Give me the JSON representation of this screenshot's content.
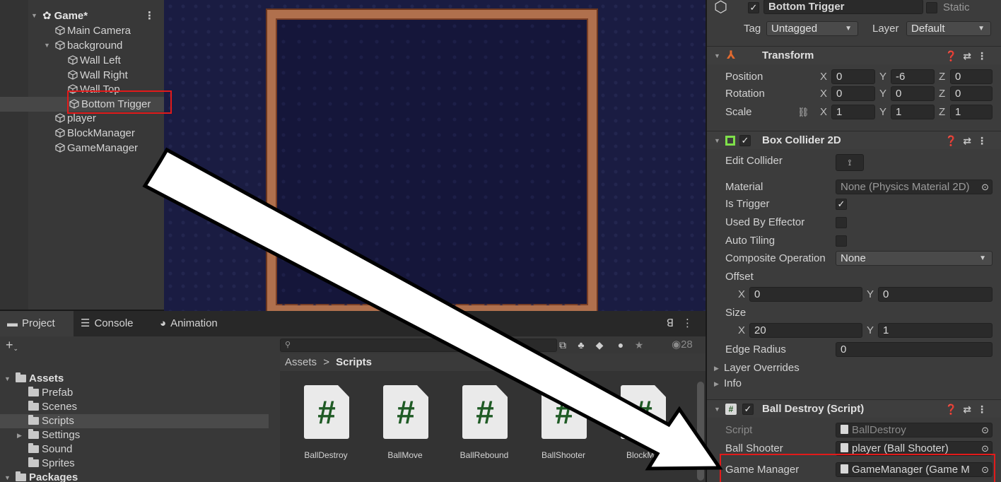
{
  "hierarchy": {
    "scene_name": "Game*",
    "items": [
      {
        "label": "Main Camera"
      },
      {
        "label": "background"
      },
      {
        "label": "Wall Left"
      },
      {
        "label": "Wall Right"
      },
      {
        "label": "Wall Top"
      },
      {
        "label": "Bottom Trigger"
      },
      {
        "label": "player"
      },
      {
        "label": "BlockManager"
      },
      {
        "label": "GameManager"
      }
    ]
  },
  "project_panel": {
    "tabs": [
      {
        "label": "Project",
        "icon": "folder-icon"
      },
      {
        "label": "Console",
        "icon": "console-icon"
      },
      {
        "label": "Animation",
        "icon": "animation-icon"
      }
    ],
    "search_placeholder": "",
    "hidden_count": "28",
    "tree": [
      {
        "label": "Assets"
      },
      {
        "label": "Prefab"
      },
      {
        "label": "Scenes"
      },
      {
        "label": "Scripts"
      },
      {
        "label": "Settings"
      },
      {
        "label": "Sound"
      },
      {
        "label": "Sprites"
      },
      {
        "label": "Packages"
      }
    ],
    "breadcrumb_root": "Assets",
    "breadcrumb_sep": ">",
    "breadcrumb_current": "Scripts",
    "assets": [
      {
        "name": "BallDestroy",
        "glyph": "#"
      },
      {
        "name": "BallMove",
        "glyph": "#"
      },
      {
        "name": "BallRebound",
        "glyph": "#"
      },
      {
        "name": "BallShooter",
        "glyph": "#"
      },
      {
        "name": "BlockMa",
        "glyph": "#"
      }
    ]
  },
  "inspector": {
    "object_name": "Bottom Trigger",
    "static_label": "Static",
    "tag_label": "Tag",
    "tag_value": "Untagged",
    "layer_label": "Layer",
    "layer_value": "Default",
    "transform": {
      "title": "Transform",
      "position_label": "Position",
      "rotation_label": "Rotation",
      "scale_label": "Scale",
      "position": {
        "x": "0",
        "y": "-6",
        "z": "0"
      },
      "rotation": {
        "x": "0",
        "y": "0",
        "z": "0"
      },
      "scale": {
        "x": "1",
        "y": "1",
        "z": "1"
      }
    },
    "box_collider": {
      "title": "Box Collider 2D",
      "edit_collider_label": "Edit Collider",
      "material_label": "Material",
      "material_value": "None (Physics Material 2D)",
      "is_trigger_label": "Is Trigger",
      "is_trigger": true,
      "used_by_effector_label": "Used By Effector",
      "auto_tiling_label": "Auto Tiling",
      "composite_label": "Composite Operation",
      "composite_value": "None",
      "offset_label": "Offset",
      "offset": {
        "x": "0",
        "y": "0"
      },
      "size_label": "Size",
      "size": {
        "x": "20",
        "y": "1"
      },
      "edge_radius_label": "Edge Radius",
      "edge_radius": "0",
      "layer_overrides_label": "Layer Overrides",
      "info_label": "Info"
    },
    "ball_destroy": {
      "title": "Ball Destroy (Script)",
      "script_label": "Script",
      "script_value": "BallDestroy",
      "ball_shooter_label": "Ball Shooter",
      "ball_shooter_value": "player (Ball Shooter)",
      "game_manager_label": "Game Manager",
      "game_manager_value": "GameManager (Game M"
    }
  },
  "colors": {
    "highlight_box": "#e21a1a",
    "hierarchy_bg": "#383838",
    "inspector_bg": "#3c3c3c",
    "scene_bg": "#1a1c42",
    "frame": "#b0704d"
  }
}
